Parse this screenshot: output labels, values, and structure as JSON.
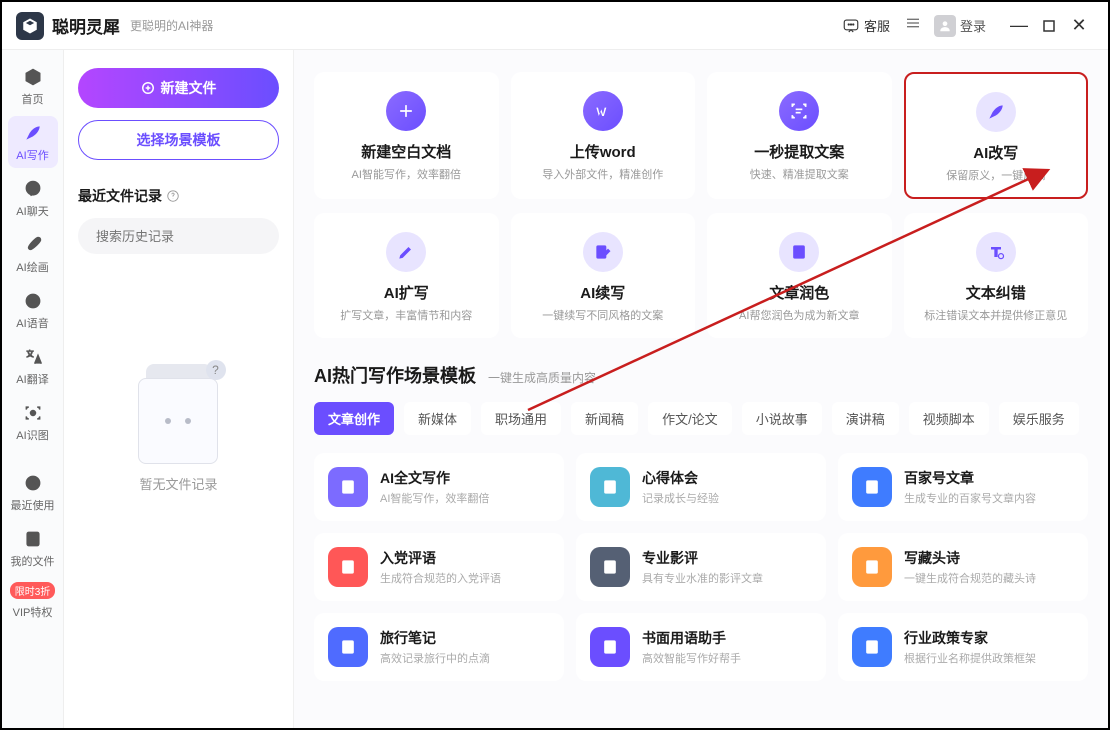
{
  "header": {
    "app_name": "聪明灵犀",
    "tagline": "更聪明的AI神器",
    "support": "客服",
    "login": "登录"
  },
  "nav": {
    "items": [
      {
        "label": "首页"
      },
      {
        "label": "AI写作"
      },
      {
        "label": "AI聊天"
      },
      {
        "label": "AI绘画"
      },
      {
        "label": "AI语音"
      },
      {
        "label": "AI翻译"
      },
      {
        "label": "AI识图"
      }
    ],
    "lower": [
      {
        "label": "最近使用"
      },
      {
        "label": "我的文件"
      },
      {
        "label": "VIP特权",
        "badge": "限时3折"
      }
    ]
  },
  "side": {
    "new_file": "新建文件",
    "choose_template": "选择场景模板",
    "recent_header": "最近文件记录",
    "search_placeholder": "搜索历史记录",
    "empty_text": "暂无文件记录"
  },
  "actions_row1": [
    {
      "title": "新建空白文档",
      "desc": "AI智能写作，效率翻倍"
    },
    {
      "title": "上传word",
      "desc": "导入外部文件，精准创作"
    },
    {
      "title": "一秒提取文案",
      "desc": "快速、精准提取文案"
    },
    {
      "title": "AI改写",
      "desc": "保留原义，一键成稿"
    }
  ],
  "actions_row2": [
    {
      "title": "AI扩写",
      "desc": "扩写文章，丰富情节和内容"
    },
    {
      "title": "AI续写",
      "desc": "一键续写不同风格的文案"
    },
    {
      "title": "文章润色",
      "desc": "AI帮您润色为成为新文章"
    },
    {
      "title": "文本纠错",
      "desc": "标注错误文本并提供修正意见"
    }
  ],
  "section": {
    "title": "AI热门写作场景模板",
    "sub": "一键生成高质量内容"
  },
  "tabs": [
    "文章创作",
    "新媒体",
    "职场通用",
    "新闻稿",
    "作文/论文",
    "小说故事",
    "演讲稿",
    "视频脚本",
    "娱乐服务"
  ],
  "templates": [
    {
      "title": "AI全文写作",
      "desc": "AI智能写作，效率翻倍",
      "color": "#7c6bff"
    },
    {
      "title": "心得体会",
      "desc": "记录成长与经验",
      "color": "#4fb8d6"
    },
    {
      "title": "百家号文章",
      "desc": "生成专业的百家号文章内容",
      "color": "#3f7cff"
    },
    {
      "title": "入党评语",
      "desc": "生成符合规范的入党评语",
      "color": "#ff5757"
    },
    {
      "title": "专业影评",
      "desc": "具有专业水准的影评文章",
      "color": "#556074"
    },
    {
      "title": "写藏头诗",
      "desc": "一键生成符合规范的藏头诗",
      "color": "#ff9a3d"
    },
    {
      "title": "旅行笔记",
      "desc": "高效记录旅行中的点滴",
      "color": "#4f6bff"
    },
    {
      "title": "书面用语助手",
      "desc": "高效智能写作好帮手",
      "color": "#6b4eff"
    },
    {
      "title": "行业政策专家",
      "desc": "根据行业名称提供政策框架",
      "color": "#3f7cff"
    }
  ]
}
